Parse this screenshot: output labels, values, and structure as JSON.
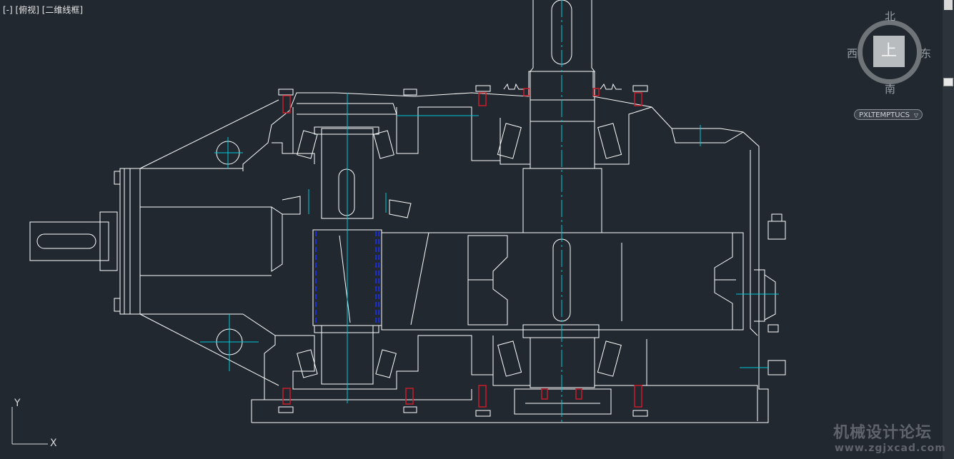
{
  "viewport": {
    "menu_label": "[-]",
    "view_label": "[俯视]",
    "style_label": "[二维线框]"
  },
  "viewcube": {
    "north": "北",
    "south": "南",
    "east": "东",
    "west": "西",
    "face": "上"
  },
  "ucs_menu": {
    "label": "PXLTEMPTUCS",
    "chevron": "▽"
  },
  "ucs_icon": {
    "x_label": "X",
    "y_label": "Y"
  },
  "watermark": {
    "title": "机械设计论坛",
    "url": "www.zgjxcad.com"
  },
  "colors": {
    "background": "#212830",
    "line": "#ffffff",
    "centerline": "#00c8d8",
    "bolt": "#c81e2a",
    "hidden": "#1e2fd0"
  }
}
